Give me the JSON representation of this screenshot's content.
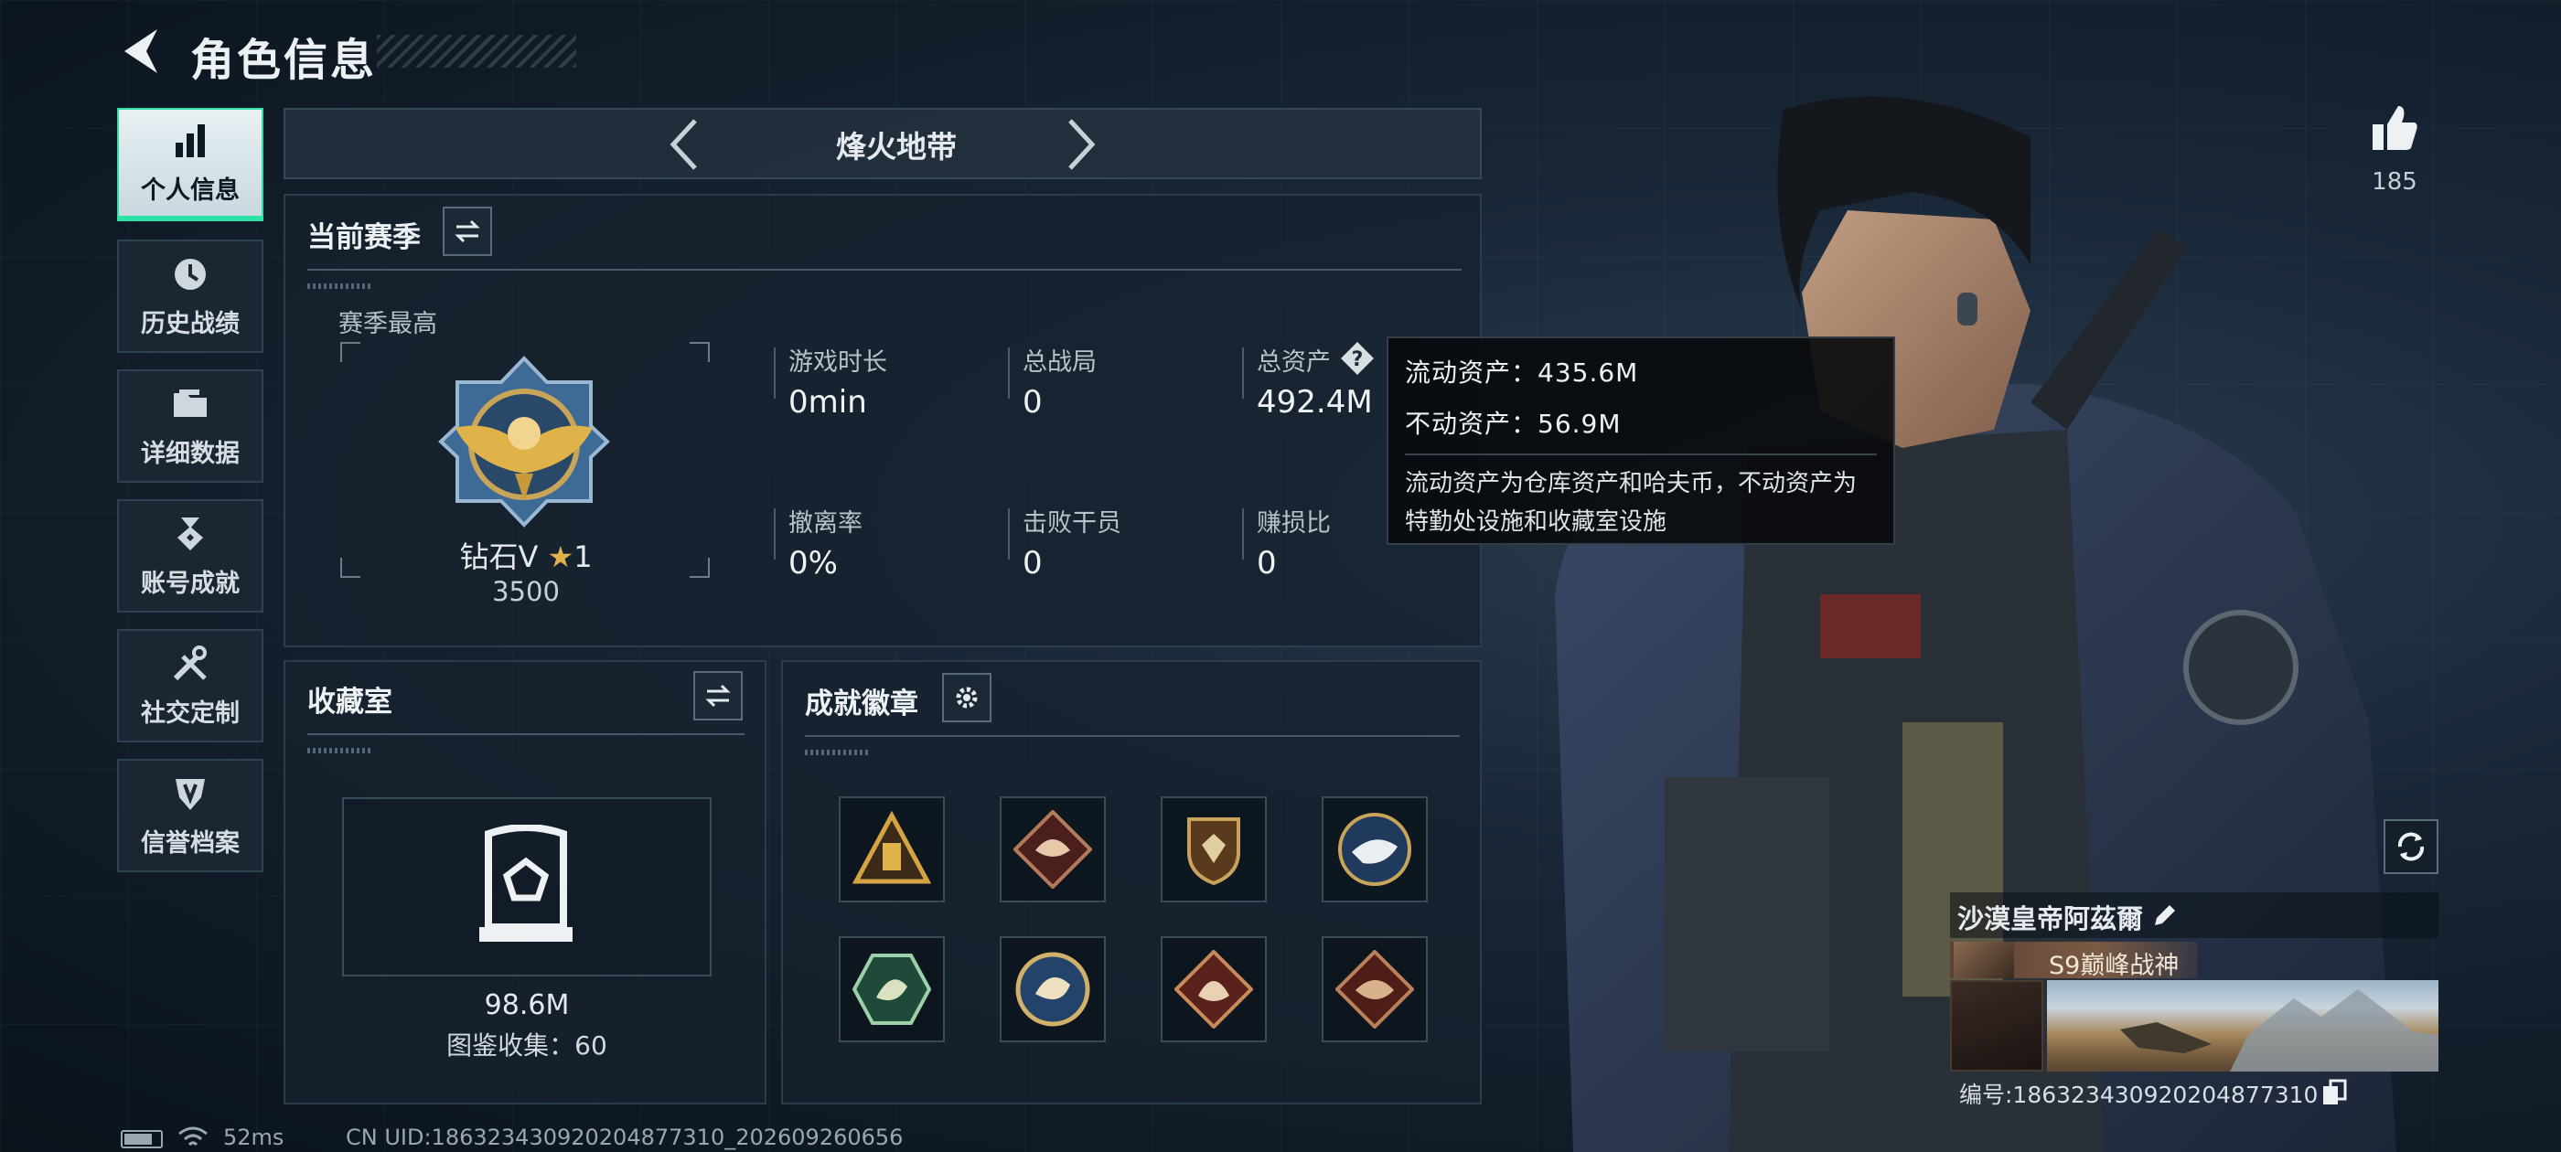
{
  "header": {
    "title": "角色信息"
  },
  "sidebar": {
    "items": [
      {
        "label": "个人信息",
        "icon": "bar-chart-icon"
      },
      {
        "label": "历史战绩",
        "icon": "clock-icon"
      },
      {
        "label": "详细数据",
        "icon": "folder-icon"
      },
      {
        "label": "账号成就",
        "icon": "medal-icon"
      },
      {
        "label": "社交定制",
        "icon": "tools-icon"
      },
      {
        "label": "信誉档案",
        "icon": "shield-icon"
      }
    ]
  },
  "mode": {
    "name": "烽火地带"
  },
  "season": {
    "title": "当前赛季",
    "best_label": "赛季最高",
    "rank": "钻石V",
    "stars": "1",
    "score": "3500",
    "stats": [
      {
        "label": "游戏时长",
        "value": "0min"
      },
      {
        "label": "总战局",
        "value": "0"
      },
      {
        "label": "总资产",
        "value": "492.4M"
      },
      {
        "label": "撤离率",
        "value": "0%"
      },
      {
        "label": "击败干员",
        "value": "0"
      },
      {
        "label": "赚损比",
        "value": "0"
      }
    ]
  },
  "tooltip": {
    "liquid": "流动资产：435.6M",
    "fixed": "不动资产：56.9M",
    "desc": "流动资产为仓库资产和哈夫币，不动资产为特勤处设施和收藏室设施"
  },
  "collection": {
    "title": "收藏室",
    "value": "98.6M",
    "catalog": "图鉴收集：60"
  },
  "achievements": {
    "title": "成就徽章",
    "badges": [
      "triangle-badge-icon",
      "diamond-beast-badge-icon",
      "shield-badge-icon",
      "eagle-round-badge-icon",
      "hex-wolf-badge-icon",
      "round-beast-badge-icon",
      "diamond-wolf-badge-icon",
      "diamond-dragon-badge-icon"
    ]
  },
  "likes": {
    "count": "185"
  },
  "profile": {
    "name": "沙漠皇帝阿茲爾",
    "title": "S9巅峰战神",
    "id": "编号:1863234309202048773​10"
  },
  "footer": {
    "ping": "52ms",
    "uid": "CN UID:186323430920204877310_202609260656"
  },
  "colors": {
    "accent": "#2ce0a6",
    "gold": "#e0b34a"
  }
}
